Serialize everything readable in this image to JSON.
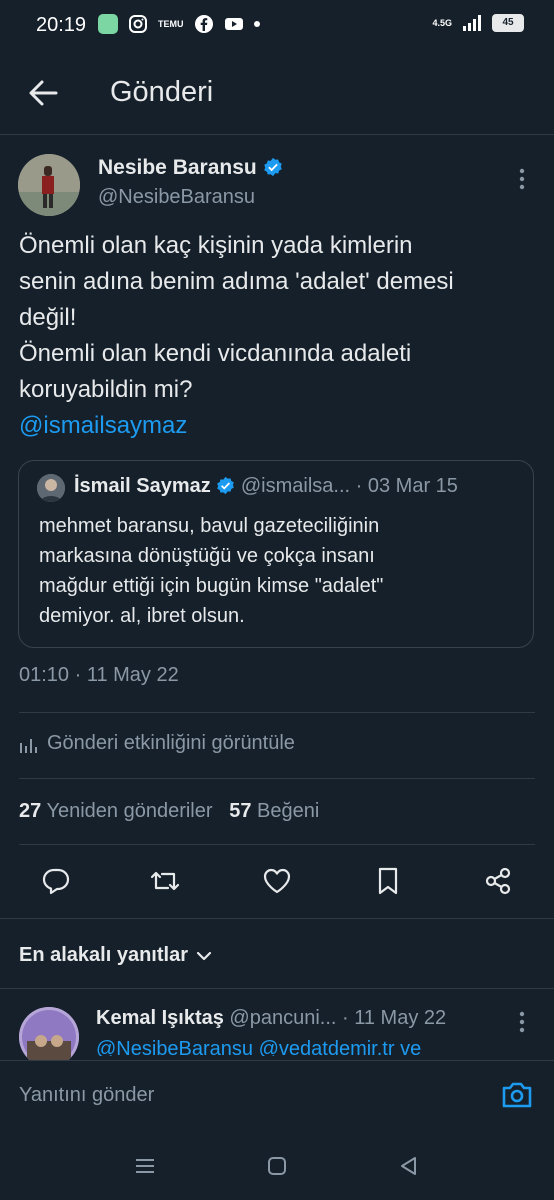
{
  "status_bar": {
    "time": "20:19",
    "temu_label": "TEMU",
    "network_label": "4.5G",
    "battery": "45"
  },
  "header": {
    "title": "Gönderi"
  },
  "tweet": {
    "author_name": "Nesibe Baransu",
    "author_handle": "@NesibeBaransu",
    "lines": [
      "Önemli olan kaç kişinin yada kimlerin",
      "senin adına benim adıma 'adalet' demesi",
      "değil!",
      "Önemli olan kendi vicdanında adaleti",
      "koruyabildin mi?"
    ],
    "mention": "@ismailsaymaz",
    "timestamp": "01:10 · 11 May 22"
  },
  "quote": {
    "author_name": "İsmail Saymaz",
    "meta": "@ismailsa... · 03 Mar 15",
    "lines": [
      "mehmet baransu, bavul gazeteciliğinin",
      "markasına dönüştüğü ve çokça insanı",
      "mağdur ettiği için bugün kimse \"adalet\"",
      "demiyor. al, ibret olsun."
    ]
  },
  "activity_label": "Gönderi etkinliğini görüntüle",
  "stats": {
    "reposts_count": "27",
    "reposts_label": "Yeniden gönderiler",
    "likes_count": "57",
    "likes_label": "Beğeni"
  },
  "replies": {
    "sort_label": "En alakalı yanıtlar",
    "first": {
      "author_name": "Kemal Işıktaş",
      "meta": "@pancuni... · 11 May 22",
      "text": "@NesibeBaransu @vedatdemir.tr ve"
    }
  },
  "compose": {
    "placeholder": "Yanıtını gönder"
  },
  "colors": {
    "background": "#15202b",
    "accent": "#1d9bf0",
    "text": "#e7e9ea",
    "muted": "#8b98a5",
    "border": "#2f3a45"
  }
}
